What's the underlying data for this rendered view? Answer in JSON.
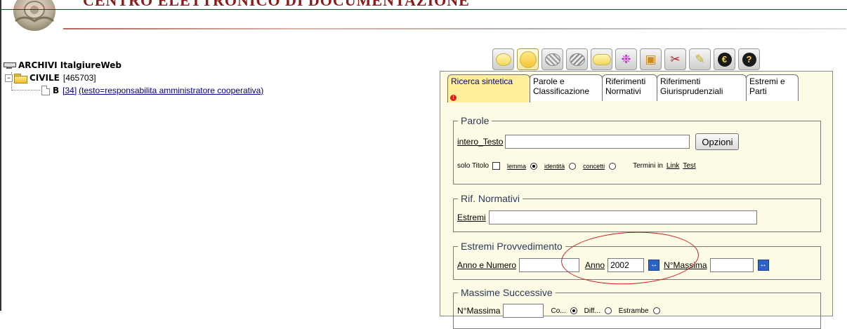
{
  "header": {
    "title": "CENTRO ELETTRONICO DI DOCUMENTAZIONE",
    "logo_icon": "emblem-logo"
  },
  "toolbar": {
    "buttons": [
      {
        "icon": "yellow-oval-small-icon"
      },
      {
        "icon": "yellow-oval-large-icon"
      },
      {
        "icon": "hatched-oval-icon"
      },
      {
        "icon": "hatched-oval-alt-icon"
      },
      {
        "icon": "yellow-pill-icon"
      },
      {
        "icon": "molecule-icon",
        "glyph": "❉"
      },
      {
        "icon": "folder-stack-icon",
        "glyph": "▣"
      },
      {
        "icon": "scissors-icon",
        "glyph": "✂"
      },
      {
        "icon": "eraser-icon",
        "glyph": "✎"
      },
      {
        "icon": "euro-coin-icon",
        "glyph": "€"
      },
      {
        "icon": "help-icon",
        "glyph": "?"
      }
    ]
  },
  "tree": {
    "root": {
      "label": "ARCHIVI ItalgiureWeb"
    },
    "archive": {
      "expander": "−",
      "name": "CIVILE",
      "count": "[465703]"
    },
    "document": {
      "letter": "B",
      "count": "[34]",
      "query": "(testo=responsabilita amministratore cooperativa)"
    }
  },
  "tabs": [
    {
      "label": "Ricerca sintetica",
      "active": true,
      "warning": "!"
    },
    {
      "label": "Parole e\nClassificazione"
    },
    {
      "label": "Riferimenti\nNormativi"
    },
    {
      "label": "Riferimenti\nGiurisprudenziali"
    },
    {
      "label": "Estremi e\nParti"
    }
  ],
  "parole": {
    "legend": "Parole",
    "intero_testo_label": "intero_Testo",
    "intero_testo_value": "",
    "opzioni_button": "Opzioni",
    "solo_titolo_label": "solo Titolo",
    "solo_titolo_checked": false,
    "radio_lemma": "lemma",
    "radio_identita": "identità",
    "radio_concetti": "concetti",
    "selected_mode": "lemma",
    "termini_label": "Termini in",
    "termini_link": "Link",
    "termini_test": "Test"
  },
  "rif_normativi": {
    "legend": "Rif. Normativi",
    "estremi_label": "Estremi",
    "estremi_value": ""
  },
  "estremi_provvedimento": {
    "legend": "Estremi Provvedimento",
    "anno_numero_label": "Anno e Numero",
    "anno_numero_value": "",
    "anno_label": "Anno",
    "anno_value": "2002",
    "nmassima_label": "N°Massima",
    "nmassima_value": "",
    "range_glyph": "↔"
  },
  "massime_successive": {
    "legend": "Massime Successive",
    "nmassima_label": "N°Massima",
    "radio_a": "Co...",
    "radio_b": "Diff...",
    "radio_c": "Estrambe"
  },
  "annotation": {
    "color": "#d21a1a"
  }
}
